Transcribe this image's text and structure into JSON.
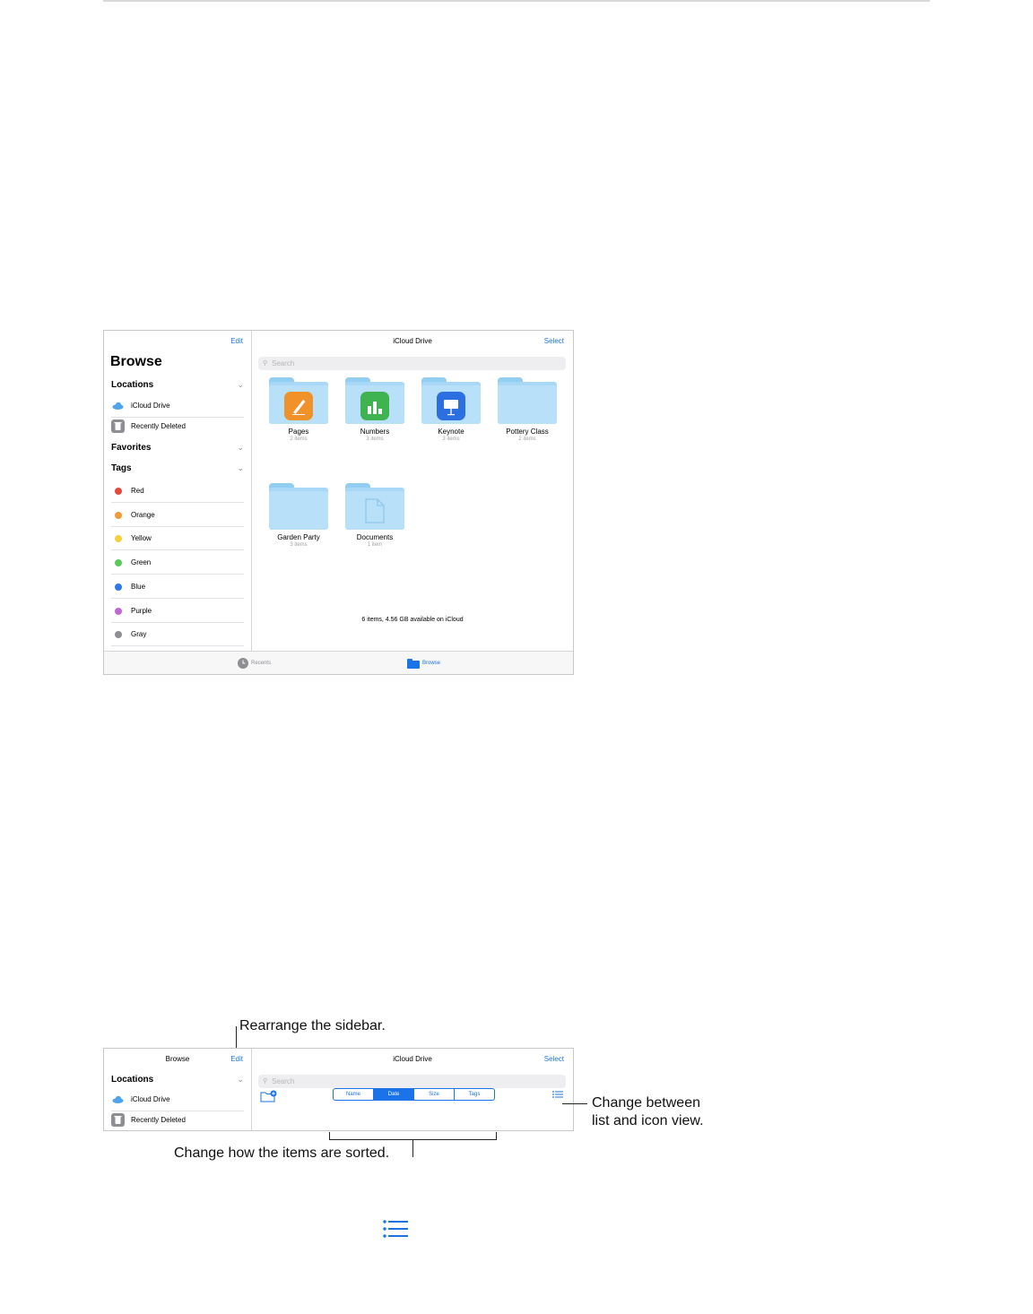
{
  "screen1": {
    "sidebar": {
      "edit_label": "Edit",
      "title": "Browse",
      "locations_label": "Locations",
      "locations": [
        {
          "label": "iCloud Drive",
          "icon": "cloud-icon"
        },
        {
          "label": "Recently Deleted",
          "icon": "trash-icon"
        }
      ],
      "favorites_label": "Favorites",
      "tags_label": "Tags",
      "tags": [
        {
          "label": "Red",
          "color": "#e5483c"
        },
        {
          "label": "Orange",
          "color": "#f19a37"
        },
        {
          "label": "Yellow",
          "color": "#f6cf3c"
        },
        {
          "label": "Green",
          "color": "#5bc85c"
        },
        {
          "label": "Blue",
          "color": "#2f78e6"
        },
        {
          "label": "Purple",
          "color": "#bd69d3"
        },
        {
          "label": "Gray",
          "color": "#8e8e93"
        }
      ]
    },
    "main": {
      "title": "iCloud Drive",
      "select_label": "Select",
      "search_placeholder": "Search",
      "folders": [
        {
          "name": "Pages",
          "count": "2 items",
          "app": "pages-icon",
          "app_color": "#f0912a"
        },
        {
          "name": "Numbers",
          "count": "3 items",
          "app": "numbers-icon",
          "app_color": "#3fb34f"
        },
        {
          "name": "Keynote",
          "count": "3 items",
          "app": "keynote-icon",
          "app_color": "#2c6fe0"
        },
        {
          "name": "Pottery Class",
          "count": "2 items",
          "app": "",
          "app_color": ""
        },
        {
          "name": "Garden Party",
          "count": "3 items",
          "app": "",
          "app_color": ""
        },
        {
          "name": "Documents",
          "count": "1 item",
          "app": "document-icon",
          "app_color": ""
        }
      ],
      "storage_status": "6 items, 4.56 GB available on iCloud"
    },
    "tabbar": {
      "recents_label": "Recents",
      "browse_label": "Browse"
    }
  },
  "screen2": {
    "sidebar": {
      "title": "Browse",
      "edit_label": "Edit",
      "locations_label": "Locations",
      "locations": [
        {
          "label": "iCloud Drive",
          "icon": "cloud-icon"
        },
        {
          "label": "Recently Deleted",
          "icon": "trash-icon"
        }
      ]
    },
    "main": {
      "title": "iCloud Drive",
      "select_label": "Select",
      "search_placeholder": "Search",
      "sort_options": [
        "Name",
        "Date",
        "Size",
        "Tags"
      ],
      "sort_selected": "Date"
    }
  },
  "callouts": {
    "rearrange": "Rearrange the sidebar.",
    "change_view_1": "Change between",
    "change_view_2": "list and icon view.",
    "sort": "Change how the items are sorted."
  },
  "colors": {
    "accent": "#1a73e8"
  }
}
